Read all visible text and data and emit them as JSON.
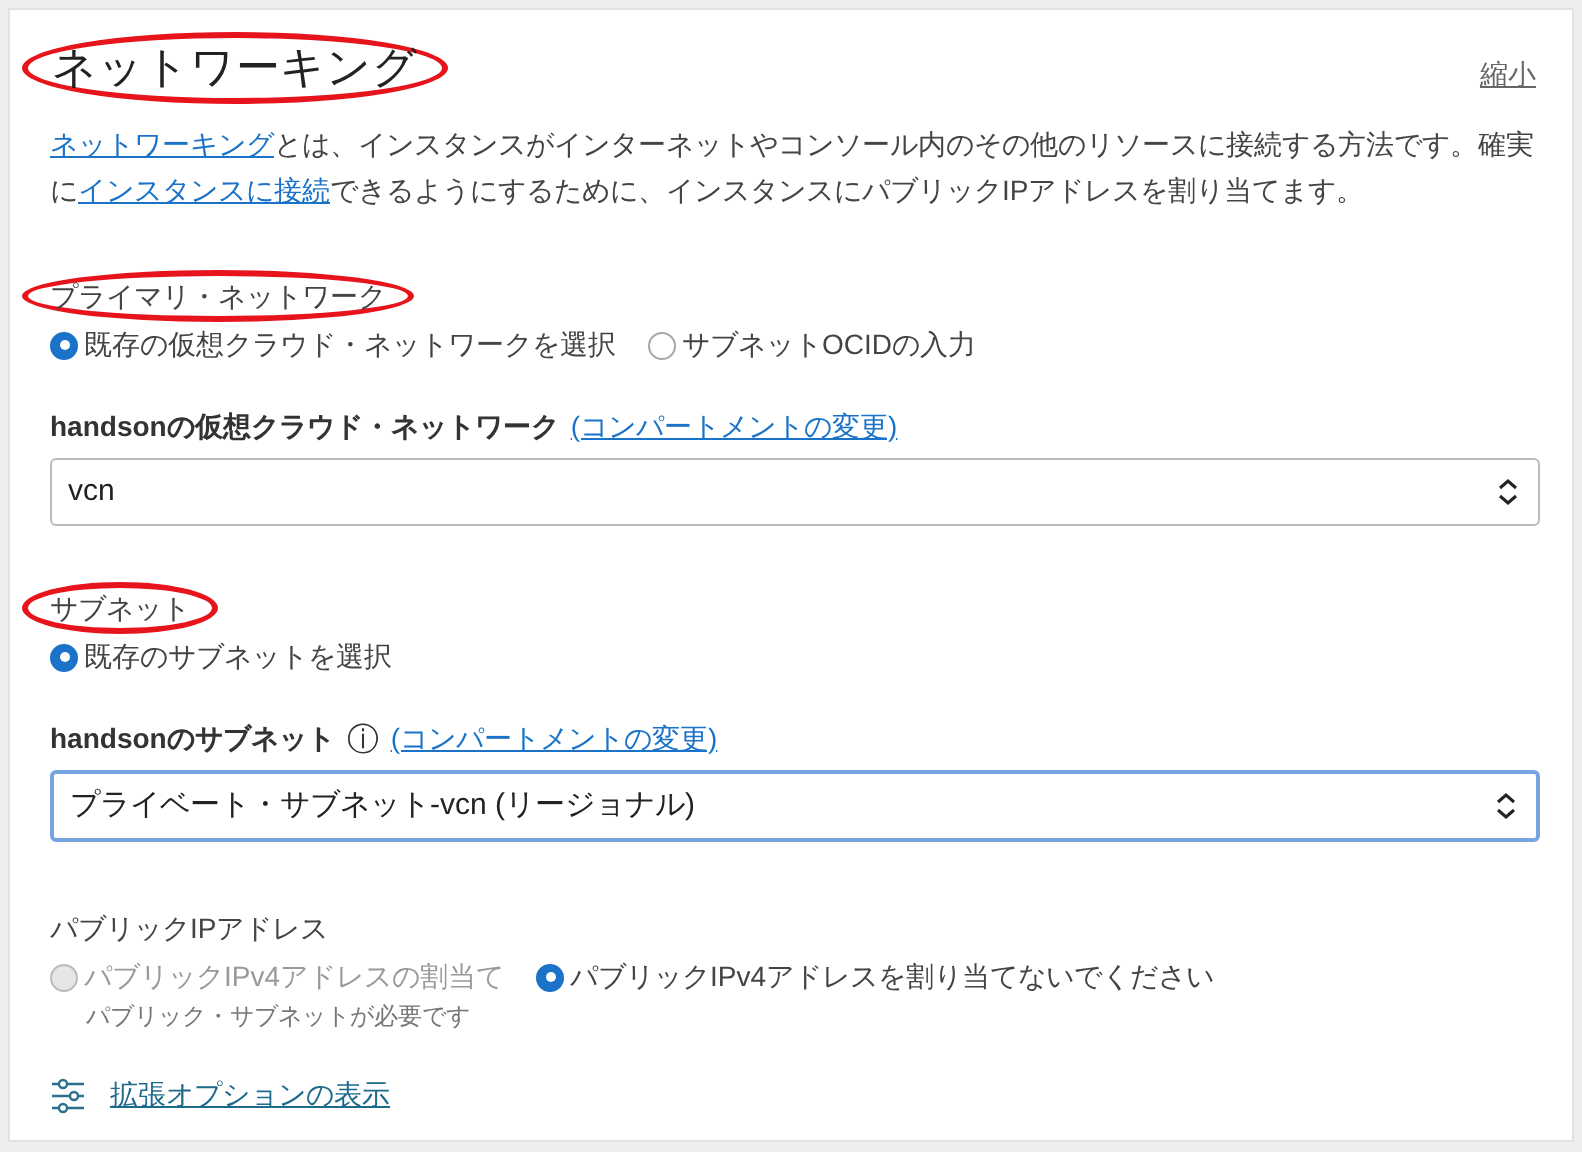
{
  "title": {
    "text": "ネットワーキング",
    "circled": true
  },
  "collapse_link": "縮小",
  "description": [
    {
      "text": "ネットワーキング",
      "link": true
    },
    {
      "text": "とは、インスタンスがインターネットやコンソール内のその他のリソースに接続する方法です。確実に",
      "link": false
    },
    {
      "text": "インスタンスに接続",
      "link": true
    },
    {
      "text": "できるようにするために、インスタンスにパブリックIPアドレスを割り当てます。",
      "link": false
    }
  ],
  "sections": [
    {
      "heading": "プライマリ・ネットワーク",
      "circled": true,
      "radios": [
        {
          "label": "既存の仮想クラウド・ネットワークを選択",
          "selected": true,
          "disabled": false
        },
        {
          "label": "サブネットOCIDの入力",
          "selected": false,
          "disabled": false
        }
      ],
      "field": {
        "label": "handsonの仮想クラウド・ネットワーク",
        "link": "(コンパートメントの変更)",
        "value": "vcn",
        "focused": false
      }
    },
    {
      "heading": "サブネット",
      "circled": true,
      "radios": [
        {
          "label": "既存のサブネットを選択",
          "selected": true,
          "disabled": false
        }
      ],
      "field": {
        "label": "handsonのサブネット",
        "info_icon": "ⓘ",
        "link": "(コンパートメントの変更)",
        "value": "プライベート・サブネット-vcn (リージョナル)",
        "focused": true
      }
    },
    {
      "heading": "パブリックIPアドレス",
      "circled": false,
      "radios": [
        {
          "label": "パブリックIPv4アドレスの割当て",
          "selected": false,
          "disabled": true,
          "hint": "パブリック・サブネットが必要です"
        },
        {
          "label": "パブリックIPv4アドレスを割り当てないでください",
          "selected": true,
          "disabled": false
        }
      ]
    }
  ],
  "advanced_link": "拡張オプションの表示"
}
